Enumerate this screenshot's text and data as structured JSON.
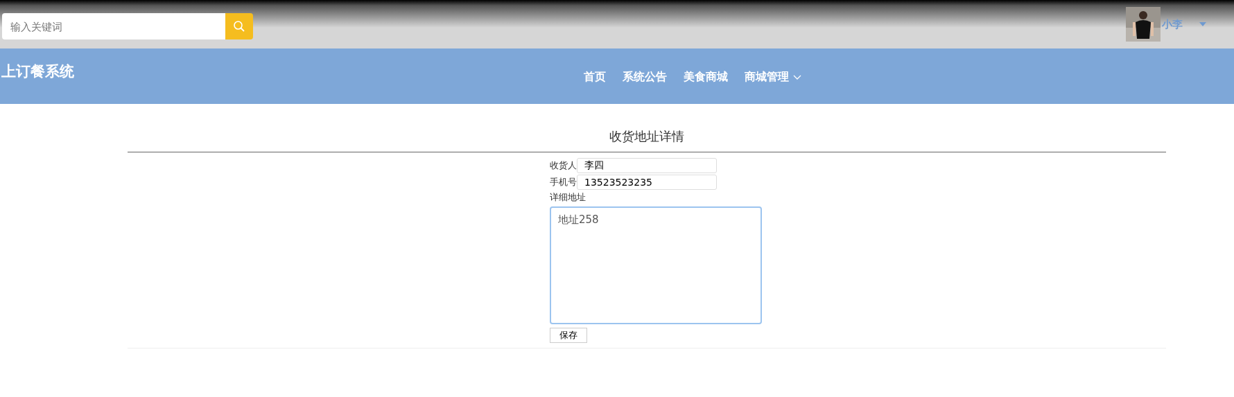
{
  "header": {
    "search": {
      "placeholder": "输入关键词"
    },
    "user": {
      "name": "小李"
    }
  },
  "navbar": {
    "title": "上订餐系统",
    "items": [
      {
        "label": "首页",
        "dropdown": false
      },
      {
        "label": "系统公告",
        "dropdown": false
      },
      {
        "label": "美食商城",
        "dropdown": false
      },
      {
        "label": "商城管理",
        "dropdown": true
      }
    ]
  },
  "page": {
    "title": "收货地址详情"
  },
  "form": {
    "fields": [
      {
        "kind": "input",
        "label": "收货人",
        "value": "李四"
      },
      {
        "kind": "input",
        "label": "手机号",
        "value": "13523523235"
      },
      {
        "kind": "textarea",
        "label": "详细地址",
        "value": "地址258"
      }
    ],
    "submit": "保存"
  }
}
